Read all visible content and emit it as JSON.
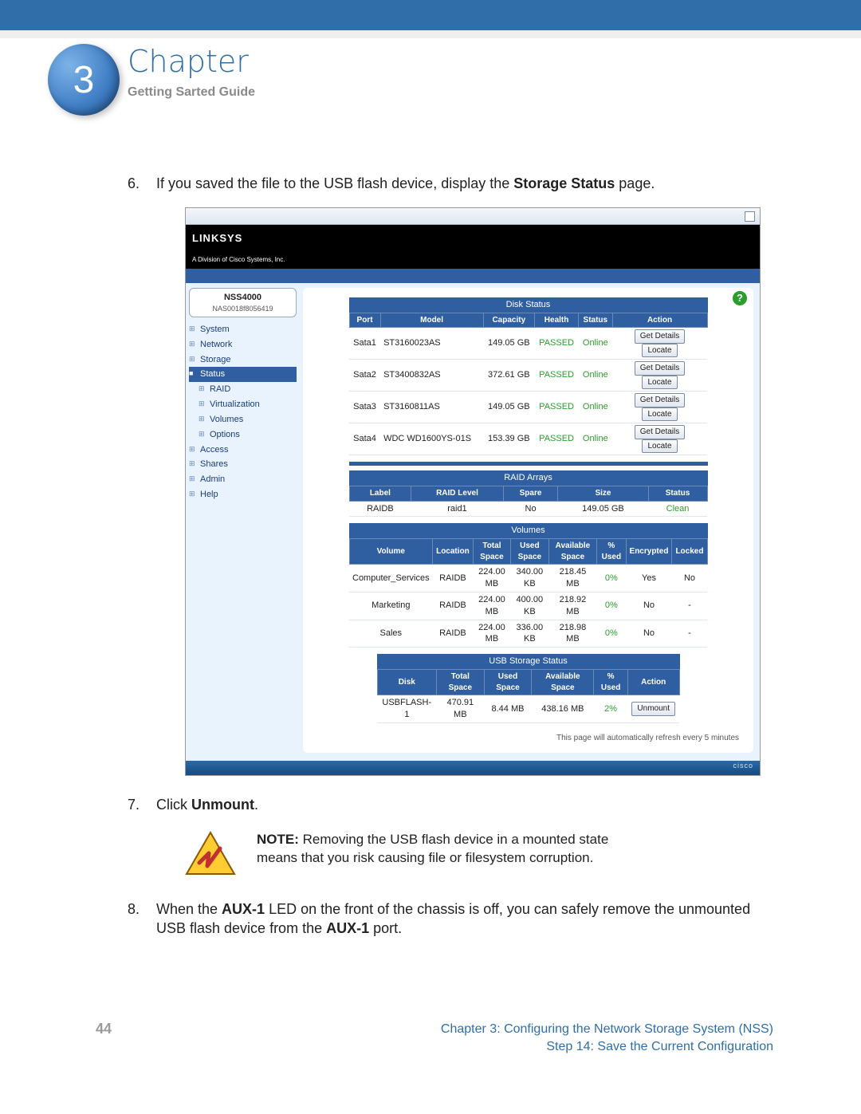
{
  "chapter": {
    "number": "3",
    "title": "Chapter",
    "subtitle": "Getting Sarted Guide"
  },
  "step6": {
    "pre": "If you saved the file to the USB flash device, display the ",
    "bold": "Storage Status",
    "post": " page."
  },
  "step7": {
    "pre": "Click ",
    "bold": "Unmount",
    "post": "."
  },
  "note": {
    "label": "NOTE:",
    "text": " Removing the USB flash device in a mounted state means that you risk causing file or filesystem corruption."
  },
  "step8": {
    "s1": "When the ",
    "b1": "AUX-1",
    "s2": " LED on the front of the chassis is off, you can safely remove the unmounted USB flash device from the ",
    "b2": "AUX-1",
    "s3": " port."
  },
  "footer": {
    "pagenum": "44",
    "line1": "Chapter 3: Configuring the Network Storage System (NSS)",
    "line2": "Step 14: Save the Current Configuration"
  },
  "shot": {
    "brand": "LINKSYS",
    "brand_sub": "A Division of Cisco Systems, Inc.",
    "device": {
      "model": "NSS4000",
      "serial": "NAS0018f8056419"
    },
    "help": "?",
    "nav": [
      "System",
      "Network",
      "Storage",
      "Status",
      "RAID",
      "Virtualization",
      "Volumes",
      "Options",
      "Access",
      "Shares",
      "Admin",
      "Help"
    ],
    "disk": {
      "title": "Disk Status",
      "headers": [
        "Port",
        "Model",
        "Capacity",
        "Health",
        "Status",
        "Action"
      ],
      "rows": [
        {
          "port": "Sata1",
          "model": "ST3160023AS",
          "cap": "149.05 GB",
          "health": "PASSED",
          "status": "Online"
        },
        {
          "port": "Sata2",
          "model": "ST3400832AS",
          "cap": "372.61 GB",
          "health": "PASSED",
          "status": "Online"
        },
        {
          "port": "Sata3",
          "model": "ST3160811AS",
          "cap": "149.05 GB",
          "health": "PASSED",
          "status": "Online"
        },
        {
          "port": "Sata4",
          "model": "WDC WD1600YS-01S",
          "cap": "153.39 GB",
          "health": "PASSED",
          "status": "Online"
        }
      ],
      "btn_details": "Get Details",
      "btn_locate": "Locate"
    },
    "raid": {
      "title": "RAID Arrays",
      "headers": [
        "Label",
        "RAID Level",
        "Spare",
        "Size",
        "Status"
      ],
      "row": {
        "label": "RAIDB",
        "level": "raid1",
        "spare": "No",
        "size": "149.05 GB",
        "status": "Clean"
      }
    },
    "volumes": {
      "title": "Volumes",
      "headers": [
        "Volume",
        "Location",
        "Total Space",
        "Used Space",
        "Available Space",
        "% Used",
        "Encrypted",
        "Locked"
      ],
      "rows": [
        {
          "v": "Computer_Services",
          "loc": "RAIDB",
          "tot": "224.00 MB",
          "used": "340.00 KB",
          "avail": "218.45 MB",
          "pct": "0%",
          "enc": "Yes",
          "lock": "No"
        },
        {
          "v": "Marketing",
          "loc": "RAIDB",
          "tot": "224.00 MB",
          "used": "400.00 KB",
          "avail": "218.92 MB",
          "pct": "0%",
          "enc": "No",
          "lock": "-"
        },
        {
          "v": "Sales",
          "loc": "RAIDB",
          "tot": "224.00 MB",
          "used": "336.00 KB",
          "avail": "218.98 MB",
          "pct": "0%",
          "enc": "No",
          "lock": "-"
        }
      ]
    },
    "usb": {
      "title": "USB Storage Status",
      "headers": [
        "Disk",
        "Total Space",
        "Used Space",
        "Available Space",
        "% Used",
        "Action"
      ],
      "row": {
        "disk": "USBFLASH-1",
        "tot": "470.91 MB",
        "used": "8.44 MB",
        "avail": "438.16 MB",
        "pct": "2%"
      },
      "btn": "Unmount"
    },
    "refresh": "This page will automatically refresh every 5 minutes",
    "cisco": "cisco"
  }
}
